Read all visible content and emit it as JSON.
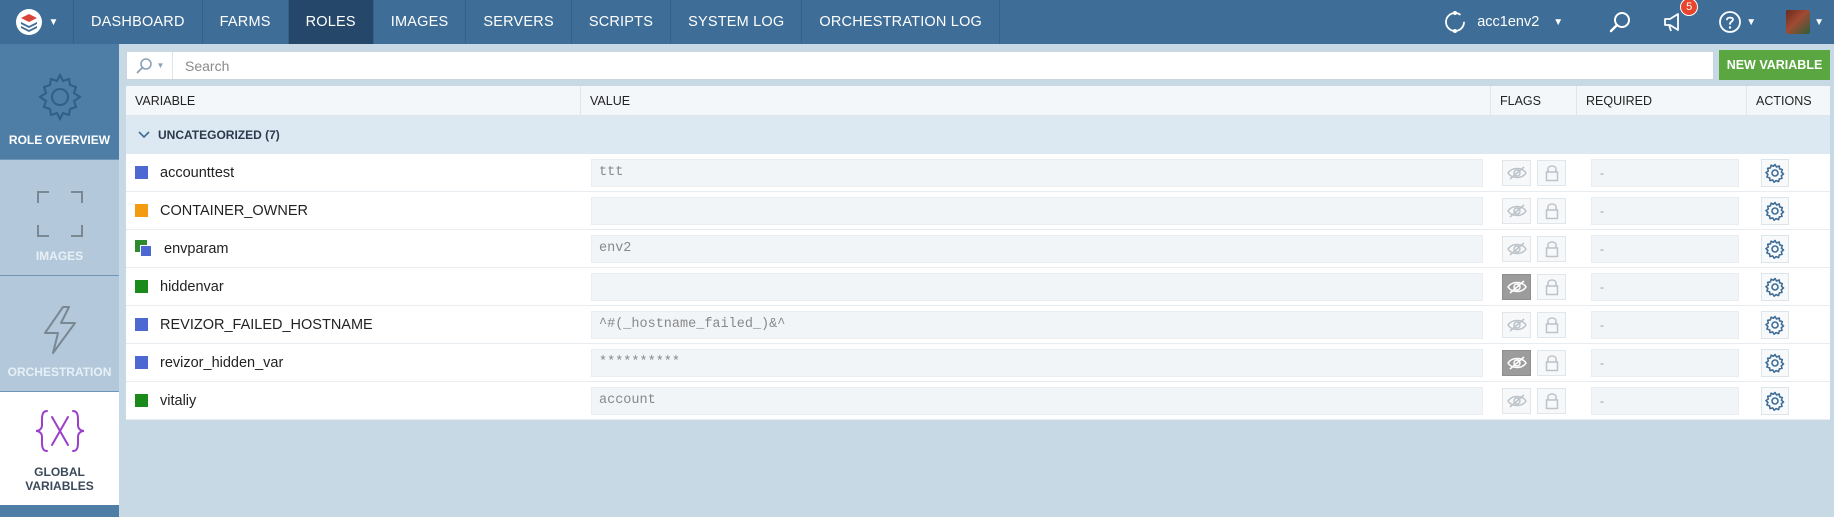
{
  "topbar": {
    "logo_icon": "stack-logo-icon",
    "nav": [
      {
        "label": "DASHBOARD"
      },
      {
        "label": "FARMS"
      },
      {
        "label": "ROLES"
      },
      {
        "label": "IMAGES"
      },
      {
        "label": "SERVERS"
      },
      {
        "label": "SCRIPTS"
      },
      {
        "label": "SYSTEM LOG"
      },
      {
        "label": "ORCHESTRATION LOG"
      }
    ],
    "active_nav": "ROLES",
    "environment": "acc1env2",
    "notifications_count": "5"
  },
  "sidebar": {
    "items": [
      {
        "label": "ROLE OVERVIEW",
        "icon": "gear-icon"
      },
      {
        "label": "IMAGES",
        "icon": "frame-icon"
      },
      {
        "label": "ORCHESTRATION",
        "icon": "lightning-icon"
      },
      {
        "label": "GLOBAL VARIABLES",
        "icon": "variable-x-icon"
      }
    ],
    "active": "GLOBAL VARIABLES"
  },
  "search": {
    "placeholder": "Search",
    "value": ""
  },
  "new_variable_label": "NEW VARIABLE",
  "table": {
    "columns": [
      "VARIABLE",
      "VALUE",
      "FLAGS",
      "REQUIRED",
      "ACTIONS"
    ],
    "group_label": "UNCATEGORIZED (7)",
    "rows": [
      {
        "name": "accounttest",
        "value": "ttt",
        "required": "-",
        "scope_color": "#4e68d3",
        "hidden": false
      },
      {
        "name": "CONTAINER_OWNER",
        "value": "",
        "required": "-",
        "scope_color": "#f39c12",
        "hidden": false
      },
      {
        "name": "envparam",
        "value": "env2",
        "required": "-",
        "scope_color": "#4e68d3",
        "hidden": false,
        "overridden": true
      },
      {
        "name": "hiddenvar",
        "value": "",
        "required": "-",
        "scope_color": "#1a8a1a",
        "hidden": true
      },
      {
        "name": "REVIZOR_FAILED_HOSTNAME",
        "value": "^#(_hostname_failed_)&^",
        "required": "-",
        "scope_color": "#4e68d3",
        "hidden": false
      },
      {
        "name": "revizor_hidden_var",
        "value": "**********",
        "required": "-",
        "scope_color": "#4e68d3",
        "hidden": true
      },
      {
        "name": "vitaliy",
        "value": "account",
        "required": "-",
        "scope_color": "#1a8a1a",
        "hidden": false
      }
    ]
  }
}
